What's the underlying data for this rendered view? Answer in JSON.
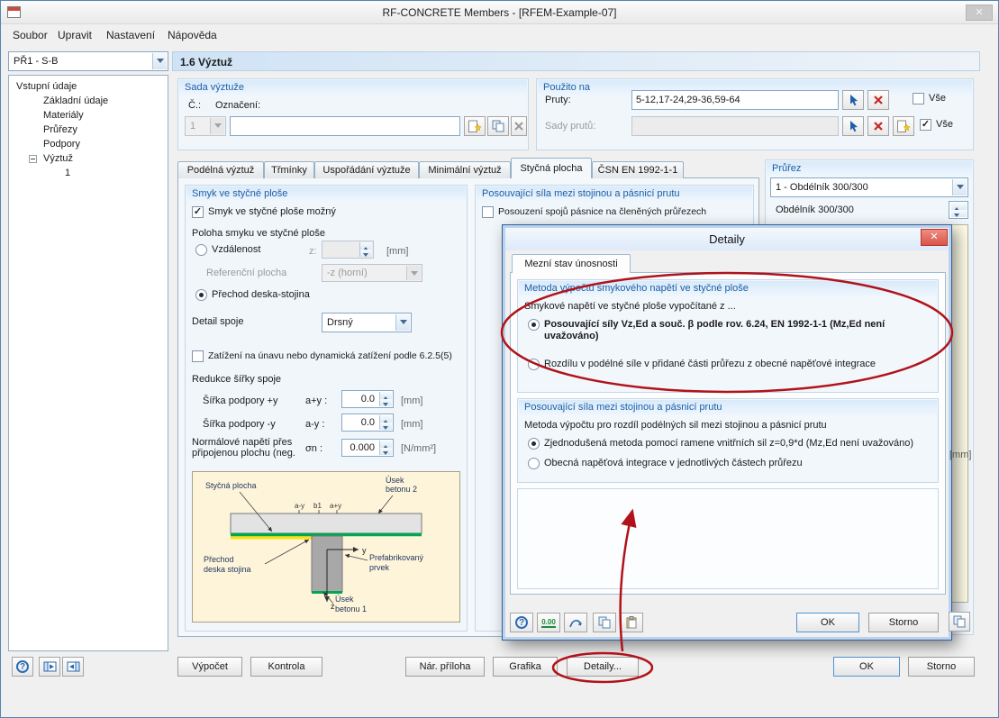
{
  "window": {
    "title": "RF-CONCRETE Members - [RFEM-Example-07]"
  },
  "icons": {
    "close": "✕",
    "check": "✓",
    "help": "?",
    "pick": "↖",
    "star": "★",
    "decimal": "0.00"
  },
  "menu": {
    "items": [
      "Soubor",
      "Upravit",
      "Nastavení",
      "Nápověda"
    ]
  },
  "sidebar": {
    "case_value": "PŘ1 - S-B",
    "tree": {
      "root": "Vstupní údaje",
      "items": [
        "Základní údaje",
        "Materiály",
        "Průřezy",
        "Podpory",
        "Výztuž"
      ],
      "child": "1"
    }
  },
  "page": {
    "title": "1.6 Výztuž"
  },
  "sada": {
    "title": "Sada výztuže",
    "no_label": "Č.:",
    "desc_label": "Označení:",
    "no_value": "1",
    "desc_value": ""
  },
  "pouzito": {
    "title": "Použito na",
    "pruty_label": "Pruty:",
    "pruty_value": "5-12,17-24,29-36,59-64",
    "sady_label": "Sady prutů:",
    "sady_value": "",
    "vse": "Vše"
  },
  "tabs": {
    "items": [
      "Podélná výztuž",
      "Třmínky",
      "Uspořádání výztuže",
      "Minimální výztuž",
      "Styčná plocha",
      "ČSN EN 1992-1-1"
    ]
  },
  "smyk": {
    "title": "Smyk ve styčné ploše",
    "cb_mozny": "Smyk ve styčné ploše možný",
    "poloha": "Poloha smyku ve styčné ploše",
    "r_vzdalenost": "Vzdálenost",
    "z_label": "z:",
    "z_value": "",
    "unit_mm": "[mm]",
    "ref_label": "Referenční plocha",
    "ref_value": "-z (horní)",
    "r_prechod": "Přechod deska-stojina",
    "detail_label": "Detail spoje",
    "detail_value": "Drsný",
    "cb_unava": "Zatížení na únavu nebo dynamická zatížení podle 6.2.5(5)",
    "redukce": "Redukce šířky spoje",
    "sirka_plus": "Šířka podpory +y",
    "a_plus_label": "a+y :",
    "a_plus_value": "0.0",
    "sirka_minus": "Šířka podpory -y",
    "a_minus_label": "a-y :",
    "a_minus_value": "0.0",
    "normal_1": "Normálové napětí přes",
    "normal_2": "připojenou plochu (neg.",
    "sigma_label": "σn :",
    "sigma_value": "0.000",
    "unit_nmm2": "[N/mm²]"
  },
  "diagram": {
    "stycna": "Styčná plocha",
    "usek2a": "Úsek",
    "usek2b": "betonu 2",
    "prechod_a": "Přechod",
    "prechod_b": "deska stojina",
    "prefab_a": "Prefabrikovaný",
    "prefab_b": "prvek",
    "usek1a": "Úsek",
    "usek1b": "betonu 1",
    "dim_ay": "a-y",
    "dim_b1": "b1",
    "dim_apy": "a+y",
    "axis_y": "y",
    "axis_z": "z"
  },
  "posouvajici": {
    "title": "Posouvající síla mezi stojinou a pásnicí prutu",
    "cb": "Posouzení spojů pásnice na členěných průřezech"
  },
  "prurez": {
    "title": "Průřez",
    "combo_value": "1 - Obdélník 300/300",
    "label": "Obdélník 300/300",
    "unit": "[mm]"
  },
  "dialog": {
    "title": "Detaily",
    "tab": "Mezní stav únosnosti",
    "g1_title": "Metoda výpočtu smykového napětí ve styčné ploše",
    "g1_text": "Smykové napětí ve styčné ploše vypočítané z ...",
    "g1_r1": "Posouvající síly Vz,Ed a souč. β podle rov. 6.24, EN 1992-1-1 (Mz,Ed není uvažováno)",
    "g1_r2": "Rozdílu v podélné síle v přidané části průřezu z obecné napěťové integrace",
    "g2_title": "Posouvající síla mezi stojinou a pásnicí prutu",
    "g2_text": "Metoda výpočtu pro rozdíl podélných sil mezi stojinou a pásnicí prutu",
    "g2_r1": "Zjednodušená metoda pomocí ramene vnitřních sil z=0,9*d (Mz,Ed není uvažováno)",
    "g2_r2": "Obecná napěťová integrace v jednotlivých částech průřezu",
    "ok": "OK",
    "storno": "Storno"
  },
  "footer": {
    "vypocet": "Výpočet",
    "kontrola": "Kontrola",
    "narodni": "Nár. příloha",
    "grafika": "Grafika",
    "detaily": "Detaily...",
    "ok": "OK",
    "storno": "Storno"
  },
  "colors": {
    "annotation": "#b0131a",
    "accent": "#1a5fa8",
    "interface_green": "#00a651"
  }
}
